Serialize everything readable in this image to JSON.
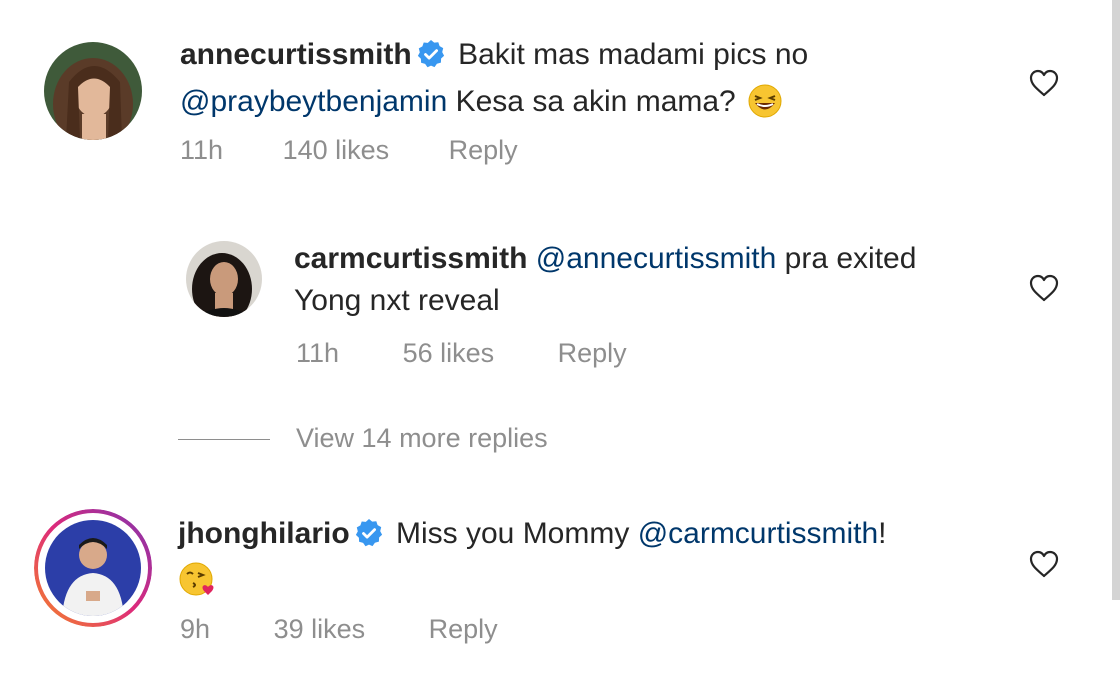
{
  "comments": [
    {
      "username": "annecurtissmith",
      "verified": true,
      "text_line1": "Bakit mas madami pics no",
      "mention": "@praybeytbenjamin",
      "text_line2": " Kesa sa akin mama?",
      "emoji": "laughing-emoji",
      "time": "11h",
      "likes": "140 likes",
      "reply_label": "Reply"
    },
    {
      "username": "carmcurtissmith",
      "verified": false,
      "mention": "@annecurtissmith",
      "text_line1": " pra exited",
      "text_line2": "Yong nxt reveal",
      "time": "11h",
      "likes": "56 likes",
      "reply_label": "Reply"
    },
    {
      "username": "jhonghilario",
      "verified": true,
      "text_line1": "Miss you Mommy ",
      "mention": "@carmcurtissmith",
      "text_line1_end": "!",
      "emoji": "kissing-emoji",
      "time": "9h",
      "likes": "39 likes",
      "reply_label": "Reply"
    }
  ],
  "view_replies_label": "View 14 more replies",
  "colors": {
    "username": "#262626",
    "mention": "#00376b",
    "meta": "#8e8e8e",
    "verified": "#3897f0",
    "story_ring": "#c13584"
  }
}
